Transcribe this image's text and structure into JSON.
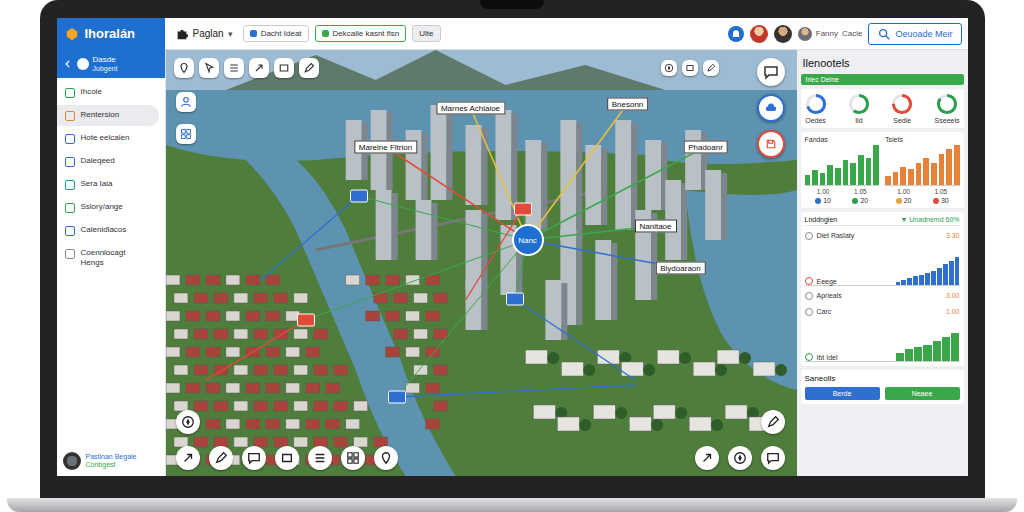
{
  "window": {
    "logo": "Ihoralán"
  },
  "toolbar": {
    "menu": {
      "label": "Paglan",
      "caret": "▾"
    },
    "fields": [
      {
        "text": "Dacht Ideat",
        "kind": "plain"
      },
      {
        "text": "Dekcaile kasnt fisn",
        "kind": "accent"
      },
      {
        "text": "Ulte",
        "kind": "chip"
      }
    ],
    "user": {
      "name": "Fanny",
      "detail": "Cacle"
    },
    "action": "Oeuoade Meir"
  },
  "sidebar": {
    "title": "Dasde",
    "subtitle": "Jubgent",
    "items": [
      {
        "label": "Ihcole",
        "selected": false,
        "color": "#2e9e4f"
      },
      {
        "label": "Rentersion",
        "selected": true,
        "color": "#e08a2c"
      },
      {
        "label": "Hote eelcalen",
        "selected": false,
        "color": "#2f6fd0"
      },
      {
        "label": "Daleqeed",
        "selected": false,
        "color": "#2f6fd0"
      },
      {
        "label": "Sera Iaia",
        "selected": false,
        "color": "#1a9a9a"
      },
      {
        "label": "Sslory/ange",
        "selected": false,
        "color": "#2e9e4f"
      },
      {
        "label": "Calenidlacos",
        "selected": false,
        "color": "#2f6fd0"
      },
      {
        "label": "Coennlocagt Hengs",
        "selected": false,
        "color": "#8a8f96"
      }
    ],
    "footer": {
      "title": "Pastinan Begale",
      "subtitle": "Conbgest"
    }
  },
  "map": {
    "hub": "Nanc",
    "labels": [
      {
        "text": "Marnes Achiaioe",
        "color": "#e8c23a"
      },
      {
        "text": "Bnesonn",
        "color": "#e8c23a"
      },
      {
        "text": "Marelne Fitrion",
        "color": "#e24a3b"
      },
      {
        "text": "Phadoanr",
        "color": "#3aa84a"
      },
      {
        "text": "Nanitaoe",
        "color": "#3aa84a"
      },
      {
        "text": "Biydoaraon",
        "color": "#2f6fd0"
      }
    ],
    "markers": [
      {
        "color": "#2f6fd0"
      },
      {
        "color": "#e24a3b"
      },
      {
        "color": "#2f6fd0"
      },
      {
        "color": "#e24a3b"
      },
      {
        "color": "#2f6fd0"
      }
    ]
  },
  "panel": {
    "title": "Ilenootels",
    "banner": "Irlec Delne",
    "donuts": [
      {
        "label": "Oedes",
        "level": 0.7,
        "color": "#2f6fd0"
      },
      {
        "label": "Ild",
        "level": 0.6,
        "color": "#2e9e4f"
      },
      {
        "label": "Sedie",
        "level": 0.75,
        "color": "#e24a3b"
      },
      {
        "label": "Sseeels",
        "level": 0.85,
        "color": "#2e9e4f"
      }
    ],
    "charts": [
      {
        "title": "Fandas",
        "color": "#3aa84a",
        "values": [
          2,
          3,
          2.5,
          4,
          3.5,
          5,
          4.5,
          6,
          5.5,
          8
        ],
        "ticks": [
          "1.00",
          "1.05"
        ],
        "legend": [
          {
            "label": "10",
            "color": "#2f6fd0"
          },
          {
            "label": "20",
            "color": "#2e9e4f"
          }
        ]
      },
      {
        "title": "Tsiets",
        "color": "#e8823a",
        "values": [
          2,
          3,
          4,
          3.5,
          5,
          6,
          5,
          7,
          8,
          9
        ],
        "ticks": [
          "1.00",
          "1.05"
        ],
        "legend": [
          {
            "label": "20",
            "color": "#e8a23a"
          },
          {
            "label": "30",
            "color": "#e24a3b"
          }
        ]
      }
    ],
    "summary": {
      "label": "Lnddngien",
      "trend": "▼",
      "value": "Unadnemd 60%"
    },
    "metrics": [
      {
        "kind": "value",
        "label": "Diet Raslaty",
        "value": "3.30",
        "color": "#8a8f96"
      },
      {
        "kind": "bars",
        "label": "Eeege",
        "color": "#e24a3b",
        "bar_color": "#2f6fd0",
        "values": [
          1,
          1.5,
          2,
          2.5,
          3,
          3.5,
          4,
          5,
          6,
          7,
          8
        ]
      },
      {
        "kind": "value",
        "label": "Aprieals",
        "value": "3.00",
        "color": "#8a8f96"
      },
      {
        "kind": "value",
        "label": "Carc",
        "value": "1.00",
        "color": "#8a8f96"
      },
      {
        "kind": "bars",
        "label": "Ibt Idel",
        "color": "#2e9e4f",
        "bar_color": "#3aa84a",
        "values": [
          2,
          3,
          3.5,
          4,
          5,
          6,
          7
        ]
      }
    ],
    "section": {
      "title": "Saneolls",
      "buttons": [
        {
          "label": "Berde",
          "color": "#2f6fd0"
        },
        {
          "label": "Neaee",
          "color": "#3aa84a"
        }
      ]
    }
  }
}
